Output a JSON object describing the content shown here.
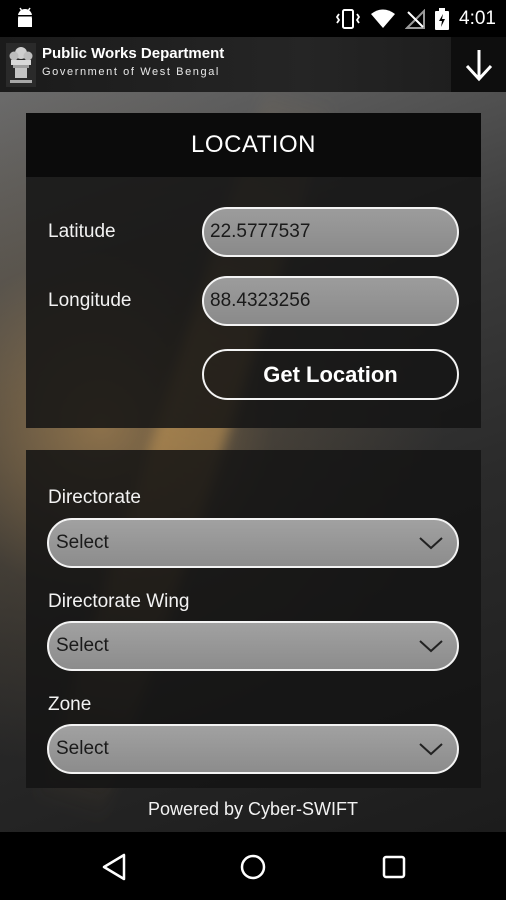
{
  "status_bar": {
    "time": "4:01",
    "icons": [
      "android-icon",
      "vibrate-icon",
      "wifi-icon",
      "no-signal-icon",
      "battery-charging-icon"
    ]
  },
  "app_bar": {
    "title": "Public Works Department",
    "subtitle": "Government of West Bengal",
    "icons": [
      "emblem-logo",
      "download-icon"
    ]
  },
  "location_panel": {
    "heading": "LOCATION",
    "latitude_label": "Latitude",
    "latitude_value": "22.5777537",
    "longitude_label": "Longitude",
    "longitude_value": "88.4323256",
    "get_location_label": "Get Location"
  },
  "selection_panel": {
    "fields": [
      {
        "label": "Directorate",
        "value": "Select"
      },
      {
        "label": "Directorate Wing",
        "value": "Select"
      },
      {
        "label": "Zone",
        "value": "Select"
      }
    ]
  },
  "footer": {
    "powered_by": "Powered by Cyber-SWIFT"
  },
  "nav_bar": {
    "icons": [
      "back-icon",
      "home-icon",
      "recents-icon"
    ]
  },
  "colors": {
    "status_bar": "#000000",
    "app_bar": "#1b1b1b",
    "panel": "#141414",
    "field": "#9a9a9a",
    "border": "#f3f3f3",
    "text": "#ffffff"
  }
}
